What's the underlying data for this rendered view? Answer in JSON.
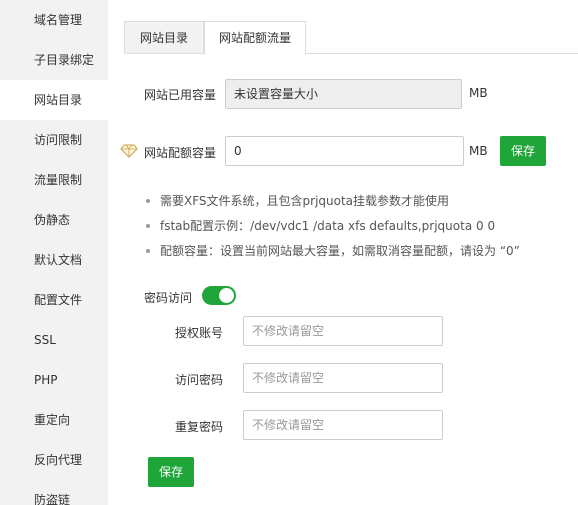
{
  "sidebar": {
    "items": [
      {
        "label": "域名管理"
      },
      {
        "label": "子目录绑定"
      },
      {
        "label": "网站目录"
      },
      {
        "label": "访问限制"
      },
      {
        "label": "流量限制"
      },
      {
        "label": "伪静态"
      },
      {
        "label": "默认文档"
      },
      {
        "label": "配置文件"
      },
      {
        "label": "SSL"
      },
      {
        "label": "PHP"
      },
      {
        "label": "重定向"
      },
      {
        "label": "反向代理"
      },
      {
        "label": "防盗链"
      }
    ],
    "active_index": 2
  },
  "tabs": [
    {
      "label": "网站目录"
    },
    {
      "label": "网站配额流量"
    }
  ],
  "quota": {
    "used_label": "网站已用容量",
    "used_value": "未设置容量大小",
    "used_unit": "MB",
    "quota_label": "网站配额容量",
    "quota_value": "0",
    "quota_unit": "MB",
    "save_label": "保存"
  },
  "notes": [
    "需要XFS文件系统，且包含prjquota挂载参数才能使用",
    "fstab配置示例：/dev/vdc1 /data xfs defaults,prjquota 0 0",
    "配额容量：设置当前网站最大容量，如需取消容量配额，请设为 “0”"
  ],
  "auth": {
    "toggle_label": "密码访问",
    "toggle_on": true,
    "account_label": "授权账号",
    "account_placeholder": "不修改请留空",
    "password_label": "访问密码",
    "password_placeholder": "不修改请留空",
    "repeat_label": "重复密码",
    "repeat_placeholder": "不修改请留空",
    "save_label": "保存"
  },
  "colors": {
    "accent": "#20a53a",
    "sidebar_bg": "#f2f2f2"
  }
}
